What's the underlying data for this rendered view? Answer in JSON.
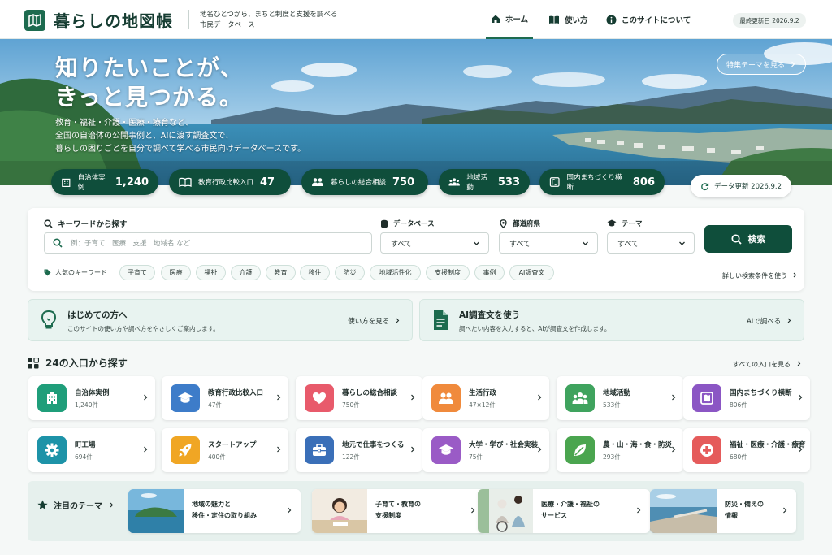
{
  "header": {
    "site_title": "暮らしの地図帳",
    "tagline_line1": "地名ひとつから、まちと制度と支援を調べる",
    "tagline_line2": "市民データベース",
    "nav": [
      {
        "label": "ホーム",
        "icon": "home-icon",
        "active": true
      },
      {
        "label": "使い方",
        "icon": "book-icon",
        "active": false
      },
      {
        "label": "このサイトについて",
        "icon": "info-icon",
        "active": false
      }
    ],
    "last_updated": "最終更新日 2026.9.2"
  },
  "hero": {
    "headline_line1": "知りたいことが、",
    "headline_line2": "きっと見つかる。",
    "sub_line1": "教育・福祉・介護・医療・療育など、",
    "sub_line2": "全国の自治体の公開事例と、AIに渡す調査文で、",
    "sub_line3": "暮らしの困りごとを自分で調べて学べる市民向けデータベースです。",
    "special_button": "特集テーマを見る",
    "stats": [
      {
        "label": "自治体実例",
        "value": "1,240",
        "icon": "building-icon"
      },
      {
        "label": "教育行政比較入口",
        "value": "47",
        "icon": "book-open-icon"
      },
      {
        "label": "暮らしの総合相談",
        "value": "750",
        "icon": "people-icon"
      },
      {
        "label": "地域活動",
        "value": "533",
        "icon": "group-icon"
      },
      {
        "label": "国内まちづくり横断",
        "value": "806",
        "icon": "map-book-icon"
      }
    ],
    "data_update": "データ更新 2026.9.2"
  },
  "search": {
    "keyword_label": "キーワードから探す",
    "keyword_placeholder": "例：子育て　医療　支援　地域名 など",
    "database_label": "データベース",
    "database_value": "すべて",
    "prefecture_label": "都道府県",
    "prefecture_value": "すべて",
    "theme_label": "テーマ",
    "theme_value": "すべて",
    "search_button": "検索",
    "popular_label": "人気のキーワード",
    "popular_keywords": [
      "子育て",
      "医療",
      "福祉",
      "介護",
      "教育",
      "移住",
      "防災",
      "地域活性化",
      "支援制度",
      "事例",
      "AI調査文"
    ],
    "advanced_link": "詳しい検索条件を使う"
  },
  "banners": [
    {
      "title": "はじめての方へ",
      "subtitle": "このサイトの使い方や調べ方をやさしくご案内します。",
      "link": "使い方を見る",
      "icon": "lightbulb-icon"
    },
    {
      "title": "AI調査文を使う",
      "subtitle": "調べたい内容を入力すると、AIが調査文を作成します。",
      "link": "AIで調べる",
      "icon": "document-icon"
    }
  ],
  "entries": {
    "title": "24の入口から探す",
    "all_link": "すべての入口を見る",
    "cards": [
      {
        "title": "自治体実例",
        "count": "1,240件",
        "icon": "building-icon",
        "color": "#1f9e7a"
      },
      {
        "title": "教育行政比較入口",
        "count": "47件",
        "icon": "graduation-cap-icon",
        "color": "#3d7cc9"
      },
      {
        "title": "暮らしの総合相談",
        "count": "750件",
        "icon": "heart-icon",
        "color": "#e85a6b"
      },
      {
        "title": "生活行政",
        "count": "47×12件",
        "icon": "people-icon",
        "color": "#f08a3c"
      },
      {
        "title": "地域活動",
        "count": "533件",
        "icon": "group-icon",
        "color": "#3fa35e"
      },
      {
        "title": "国内まちづくり横断",
        "count": "806件",
        "icon": "map-book-icon",
        "color": "#8b56c4"
      },
      {
        "title": "町工場",
        "count": "694件",
        "icon": "gear-icon",
        "color": "#1d93a8"
      },
      {
        "title": "スタートアップ",
        "count": "400件",
        "icon": "rocket-icon",
        "color": "#f0a624"
      },
      {
        "title": "地元で仕事をつくる",
        "count": "122件",
        "icon": "briefcase-icon",
        "color": "#3a6fb8"
      },
      {
        "title": "大学・学び・社会実装",
        "count": "75件",
        "icon": "graduation-cap-icon",
        "color": "#9a5bc6"
      },
      {
        "title": "農・山・海・食・防災",
        "count": "293件",
        "icon": "leaf-icon",
        "color": "#4aa54f"
      },
      {
        "title": "福祉・医療・介護・療育",
        "count": "680件",
        "icon": "medical-cross-icon",
        "color": "#e55b5b"
      }
    ]
  },
  "featured": {
    "label": "注目のテーマ",
    "items": [
      {
        "line1": "地域の魅力と",
        "line2": "移住・定住の取り組み",
        "image": "coastal-island-photo"
      },
      {
        "line1": "子育て・教育の",
        "line2": "支援制度",
        "image": "child-studying-photo"
      },
      {
        "line1": "医療・介護・福祉の",
        "line2": "サービス",
        "image": "elderly-care-photo"
      },
      {
        "line1": "防災・備えの",
        "line2": "情報",
        "image": "breakwater-coast-photo"
      }
    ]
  },
  "colors": {
    "primary": "#0f4e3b",
    "brand": "#1d6b4f",
    "accent_bg": "#e8f3f0"
  }
}
